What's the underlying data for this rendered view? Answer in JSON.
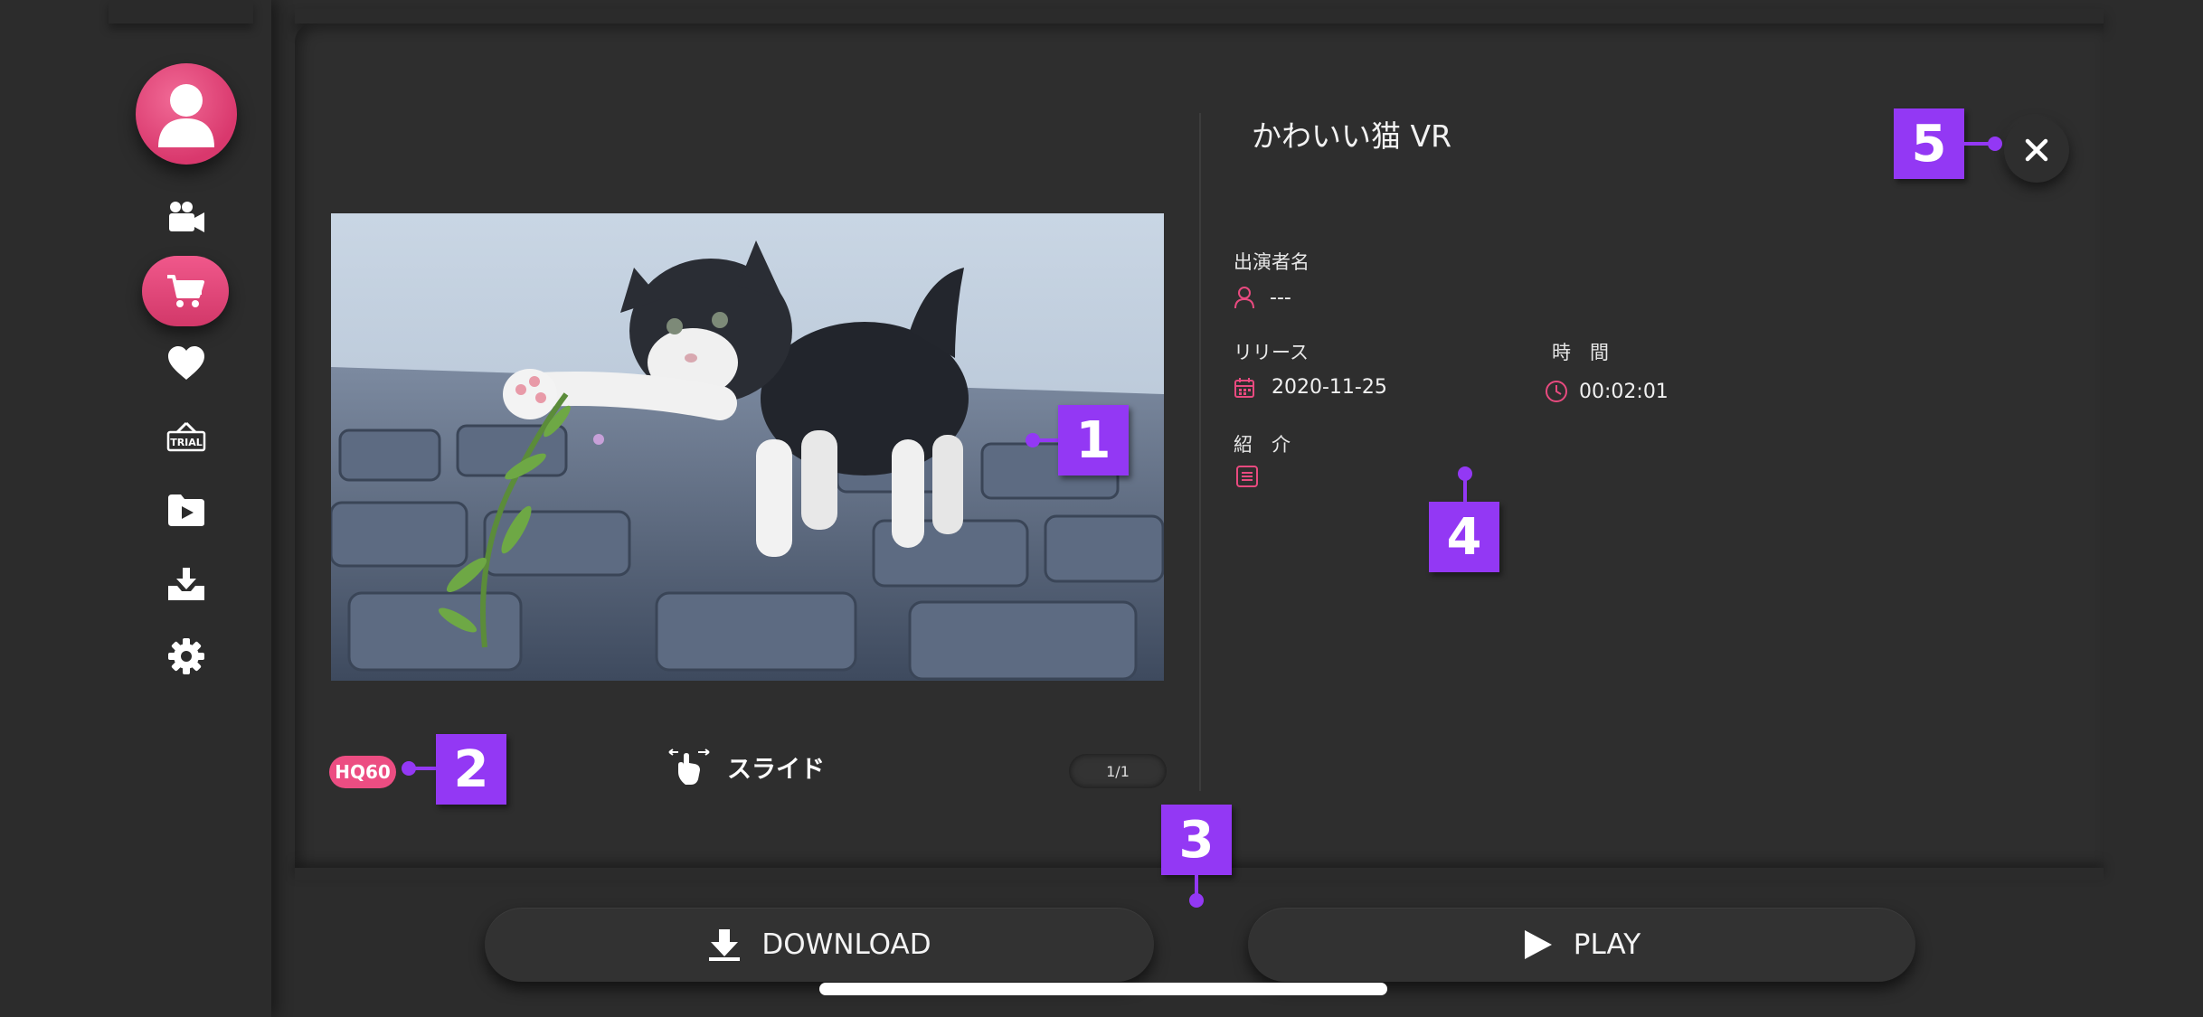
{
  "sidebar": {
    "items": [
      {
        "icon": "profile-icon"
      },
      {
        "icon": "video-camera-icon"
      },
      {
        "icon": "cart-icon",
        "active": true
      },
      {
        "icon": "heart-icon"
      },
      {
        "icon": "trial-icon",
        "label": "TRIAL"
      },
      {
        "icon": "folder-play-icon"
      },
      {
        "icon": "download-tray-icon"
      },
      {
        "icon": "gear-icon"
      }
    ],
    "accent": "#e84a7f"
  },
  "detail": {
    "title": "かわいい猫 VR",
    "performer_label": "出演者名",
    "performer_value": "---",
    "release_label": "リリース",
    "release_value": "2020-11-25",
    "duration_label": "時　間",
    "duration_value": "00:02:01",
    "intro_label": "紹　介"
  },
  "media": {
    "quality_badge": "HQ60",
    "slide_label": "スライド",
    "pager": "1/1"
  },
  "actions": {
    "download_label": "DOWNLOAD",
    "play_label": "PLAY"
  },
  "callouts": [
    "1",
    "2",
    "3",
    "4",
    "5"
  ],
  "colors": {
    "background": "#2c2c2c",
    "callout": "#9338f4",
    "badge": "#ec4d82"
  }
}
